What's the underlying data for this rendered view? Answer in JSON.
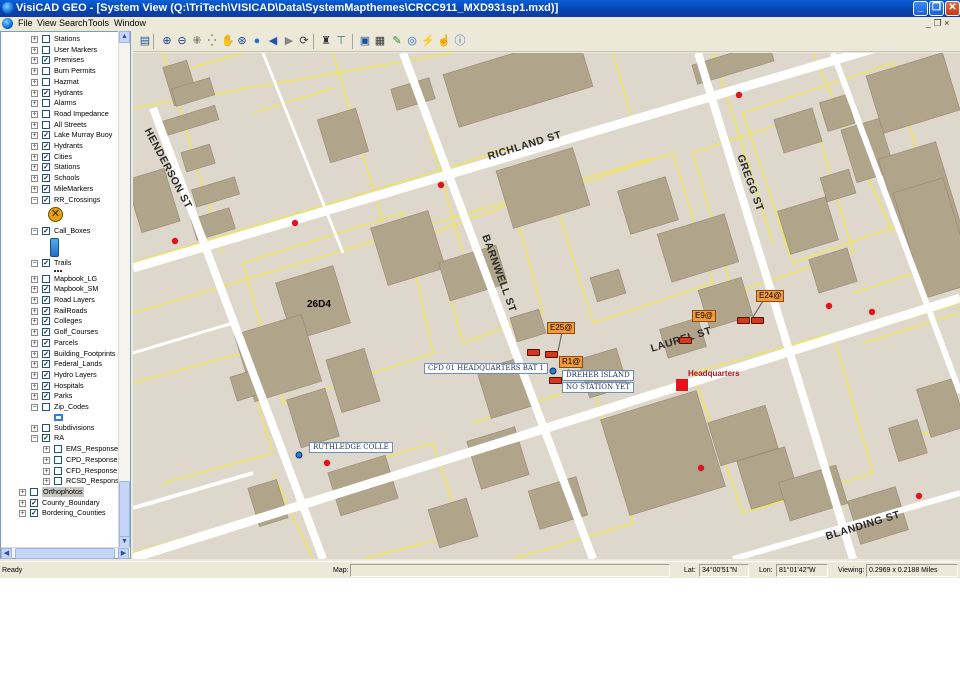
{
  "window": {
    "title": "VisiCAD GEO - [System View (Q:\\TriTech\\VISICAD\\Data\\SystemMapthemes\\CRCC911_MXD931sp1.mxd)]",
    "min_label": "_",
    "max_label": "❐",
    "close_label": "✕"
  },
  "menu": {
    "items": [
      {
        "label": "File"
      },
      {
        "label": "View"
      },
      {
        "label": "Search"
      },
      {
        "label": "Tools"
      },
      {
        "label": "Window"
      }
    ],
    "mdi_controls": "_ ❐ ×"
  },
  "layers": [
    {
      "label": "Stations",
      "checked": false,
      "expander": "+"
    },
    {
      "label": "User Markers",
      "checked": false,
      "expander": "+"
    },
    {
      "label": "Premises",
      "checked": true,
      "expander": "+"
    },
    {
      "label": "Burn Permits",
      "checked": false,
      "expander": "+"
    },
    {
      "label": "Hazmat",
      "checked": false,
      "expander": "+"
    },
    {
      "label": "Hydrants",
      "checked": true,
      "expander": "+"
    },
    {
      "label": "Alarms",
      "checked": false,
      "expander": "+"
    },
    {
      "label": "Road Impedance",
      "checked": false,
      "expander": "+"
    },
    {
      "label": "All Streets",
      "checked": false,
      "expander": "+"
    },
    {
      "label": "Lake Murray Buoy",
      "checked": true,
      "expander": "+"
    },
    {
      "label": "Hydrants",
      "checked": true,
      "expander": "+"
    },
    {
      "label": "Cities",
      "checked": true,
      "expander": "+"
    },
    {
      "label": "Stations",
      "checked": true,
      "expander": "+"
    },
    {
      "label": "Schools",
      "checked": true,
      "expander": "+"
    },
    {
      "label": "MileMarkers",
      "checked": true,
      "expander": "+"
    },
    {
      "label": "RR_Crossings",
      "checked": true,
      "expander": "−"
    },
    {
      "label": "Call_Boxes",
      "checked": true,
      "expander": "−"
    },
    {
      "label": "Trails",
      "checked": true,
      "expander": "−"
    },
    {
      "label": "Mapbook_LG",
      "checked": false,
      "expander": "+"
    },
    {
      "label": "Mapbook_SM",
      "checked": true,
      "expander": "+"
    },
    {
      "label": "Road Layers",
      "checked": true,
      "expander": "+"
    },
    {
      "label": "RailRoads",
      "checked": true,
      "expander": "+"
    },
    {
      "label": "Colleges",
      "checked": true,
      "expander": "+"
    },
    {
      "label": "Golf_Courses",
      "checked": true,
      "expander": "+"
    },
    {
      "label": "Parcels",
      "checked": true,
      "expander": "+"
    },
    {
      "label": "Building_Footprints",
      "checked": true,
      "expander": "+"
    },
    {
      "label": "Federal_Lands",
      "checked": true,
      "expander": "+"
    },
    {
      "label": "Hydro Layers",
      "checked": true,
      "expander": "+"
    },
    {
      "label": "Hospitals",
      "checked": true,
      "expander": "+"
    },
    {
      "label": "Parks",
      "checked": true,
      "expander": "+"
    },
    {
      "label": "Zip_Codes",
      "checked": false,
      "expander": "−"
    },
    {
      "label": "Subdivisions",
      "checked": false,
      "expander": "+"
    },
    {
      "label": "RA",
      "checked": true,
      "expander": "−"
    },
    {
      "label": "EMS_Response",
      "checked": false,
      "expander": "+"
    },
    {
      "label": "CPD_Response",
      "checked": false,
      "expander": "+"
    },
    {
      "label": "CFD_Response",
      "checked": false,
      "expander": "+"
    },
    {
      "label": "RCSD_Respons",
      "checked": false,
      "expander": "+"
    },
    {
      "label": "Orthophotos",
      "checked": false,
      "expander": "+"
    },
    {
      "label": "County_Boundary",
      "checked": true,
      "expander": "+"
    },
    {
      "label": "Bordering_Counties",
      "checked": true,
      "expander": "+"
    }
  ],
  "toolbar_tools": [
    "layers-icon",
    "zoom-in-icon",
    "zoom-out-icon",
    "fixed-zoom-in-icon",
    "fixed-zoom-out-icon",
    "pan-icon",
    "zoom-to-icon",
    "full-extent-icon",
    "back-icon",
    "forward-icon",
    "refresh-icon",
    "find-icon",
    "measure-icon",
    "select-features-icon",
    "clear-selection-icon",
    "identify-icon",
    "magnify-icon",
    "hyperlink-icon",
    "hand-icon",
    "info-icon"
  ],
  "map": {
    "streets": [
      "HENDERSON ST",
      "RICHLAND ST",
      "GREGG ST",
      "BARNWELL ST",
      "LAUREL ST",
      "BLANDING ST"
    ],
    "grid_label": "26D4",
    "units": [
      "E25@",
      "R1@",
      "E9@",
      "E24@"
    ],
    "callouts": [
      "CFD 01 HEADQUARTERS BAT 1",
      "DREHER ISLAND",
      "NO STATION YET",
      "RUTHLEDGE COLLE"
    ],
    "headquarters_label": "Headquarters",
    "colors": {
      "background": "#ddd8cb",
      "building": "#b0a48b",
      "parcel": "#f2e64a",
      "street": "#ffffff",
      "hydrant": "#e0141c",
      "unit": "#f39a3c",
      "headquarters": "#e8141c"
    }
  },
  "status": {
    "ready": "Ready",
    "map_label": "Map:",
    "map_value": "",
    "lat_label": "Lat:",
    "lat_value": "34°00'51\"N",
    "lon_label": "Lon:",
    "lon_value": "81°01'42\"W",
    "viewing_label": "Viewing:",
    "viewing_value": "0.2969 x 0.2188 Miles"
  }
}
